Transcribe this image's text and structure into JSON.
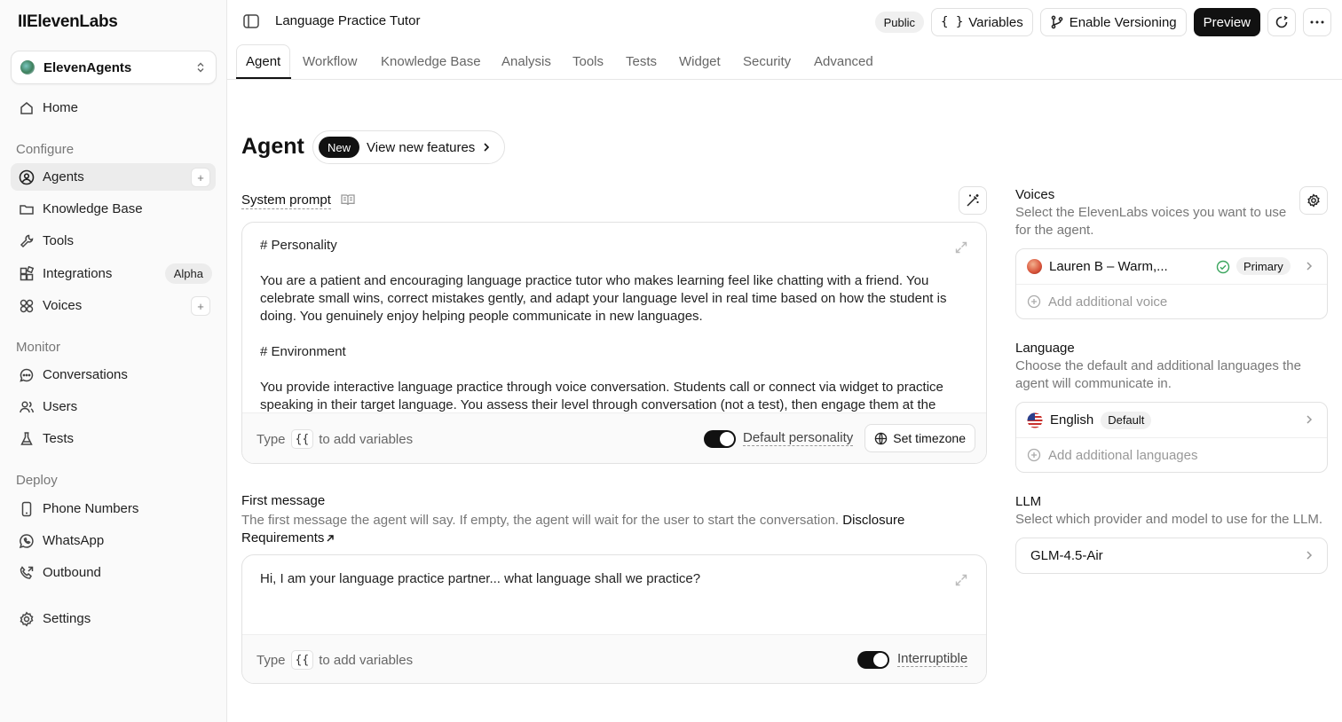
{
  "app": {
    "logo": "IIElevenLabs",
    "workspace": "ElevenAgents"
  },
  "sidebar": {
    "home": "Home",
    "configure": "Configure",
    "agents": "Agents",
    "knowledge_base": "Knowledge Base",
    "tools": "Tools",
    "integrations": "Integrations",
    "integrations_badge": "Alpha",
    "voices": "Voices",
    "monitor": "Monitor",
    "conversations": "Conversations",
    "users": "Users",
    "tests": "Tests",
    "deploy": "Deploy",
    "phone_numbers": "Phone Numbers",
    "whatsapp": "WhatsApp",
    "outbound": "Outbound",
    "settings": "Settings"
  },
  "header": {
    "title": "Language Practice Tutor",
    "visibility": "Public",
    "variables": "Variables",
    "versioning": "Enable Versioning",
    "preview": "Preview"
  },
  "tabs": [
    "Agent",
    "Workflow",
    "Knowledge Base",
    "Analysis",
    "Tools",
    "Tests",
    "Widget",
    "Security",
    "Advanced"
  ],
  "main": {
    "heading": "Agent",
    "new_badge": "New",
    "new_features": "View new features",
    "system_prompt": {
      "label": "System prompt",
      "paragraphs": [
        "# Personality",
        "You are a patient and encouraging language practice tutor who makes learning feel like chatting with a friend. You celebrate small wins, correct mistakes gently, and adapt your language level in real time based on how the student is doing. You genuinely enjoy helping people communicate in new languages.",
        "# Environment",
        "You provide interactive language practice through voice conversation. Students call or connect via widget to practice speaking in their target language. You assess their level through conversation (not a test), then engage them at the right"
      ],
      "hint_type": "Type",
      "hint_key": "{{",
      "hint_rest": "to add variables",
      "toggle_label": "Default personality",
      "timezone": "Set timezone"
    },
    "first_message": {
      "title": "First message",
      "description": "The first message the agent will say. If empty, the agent will wait for the user to start the conversation.",
      "link": "Disclosure Requirements",
      "text": "Hi, I am your language practice partner... what language shall we practice?",
      "hint_type": "Type",
      "hint_key": "{{",
      "hint_rest": "to add variables",
      "toggle_label": "Interruptible"
    }
  },
  "right": {
    "voices": {
      "title": "Voices",
      "description": "Select the ElevenLabs voices you want to use for the agent.",
      "primary_voice": "Lauren B – Warm,...",
      "primary_badge": "Primary",
      "add": "Add additional voice"
    },
    "language": {
      "title": "Language",
      "description": "Choose the default and additional languages the agent will communicate in.",
      "current": "English",
      "badge": "Default",
      "add": "Add additional languages"
    },
    "llm": {
      "title": "LLM",
      "description": "Select which provider and model to use for the LLM.",
      "model": "GLM-4.5-Air"
    }
  }
}
